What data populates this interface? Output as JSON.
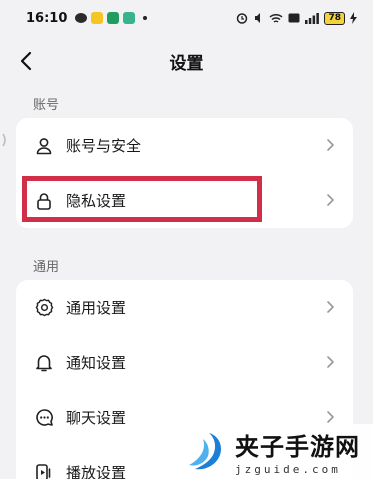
{
  "status_bar": {
    "time": "16:10",
    "battery": "78"
  },
  "header": {
    "title": "设置"
  },
  "account_section": {
    "label": "账号",
    "items": [
      {
        "label": "账号与安全",
        "icon": "person-icon"
      },
      {
        "label": "隐私设置",
        "icon": "lock-icon"
      }
    ]
  },
  "general_section": {
    "label": "通用",
    "items": [
      {
        "label": "通用设置",
        "icon": "gear-icon"
      },
      {
        "label": "通知设置",
        "icon": "bell-icon"
      },
      {
        "label": "聊天设置",
        "icon": "chat-bubble-icon"
      },
      {
        "label": "播放设置",
        "icon": "play-device-icon"
      }
    ]
  },
  "colors": {
    "highlight": "#d12f47",
    "background": "#f2f2f4",
    "card": "#ffffff",
    "watermark_logo": "#1b7fd6"
  },
  "watermark": {
    "title": "夹子手游网",
    "url": "jzguide.com"
  }
}
